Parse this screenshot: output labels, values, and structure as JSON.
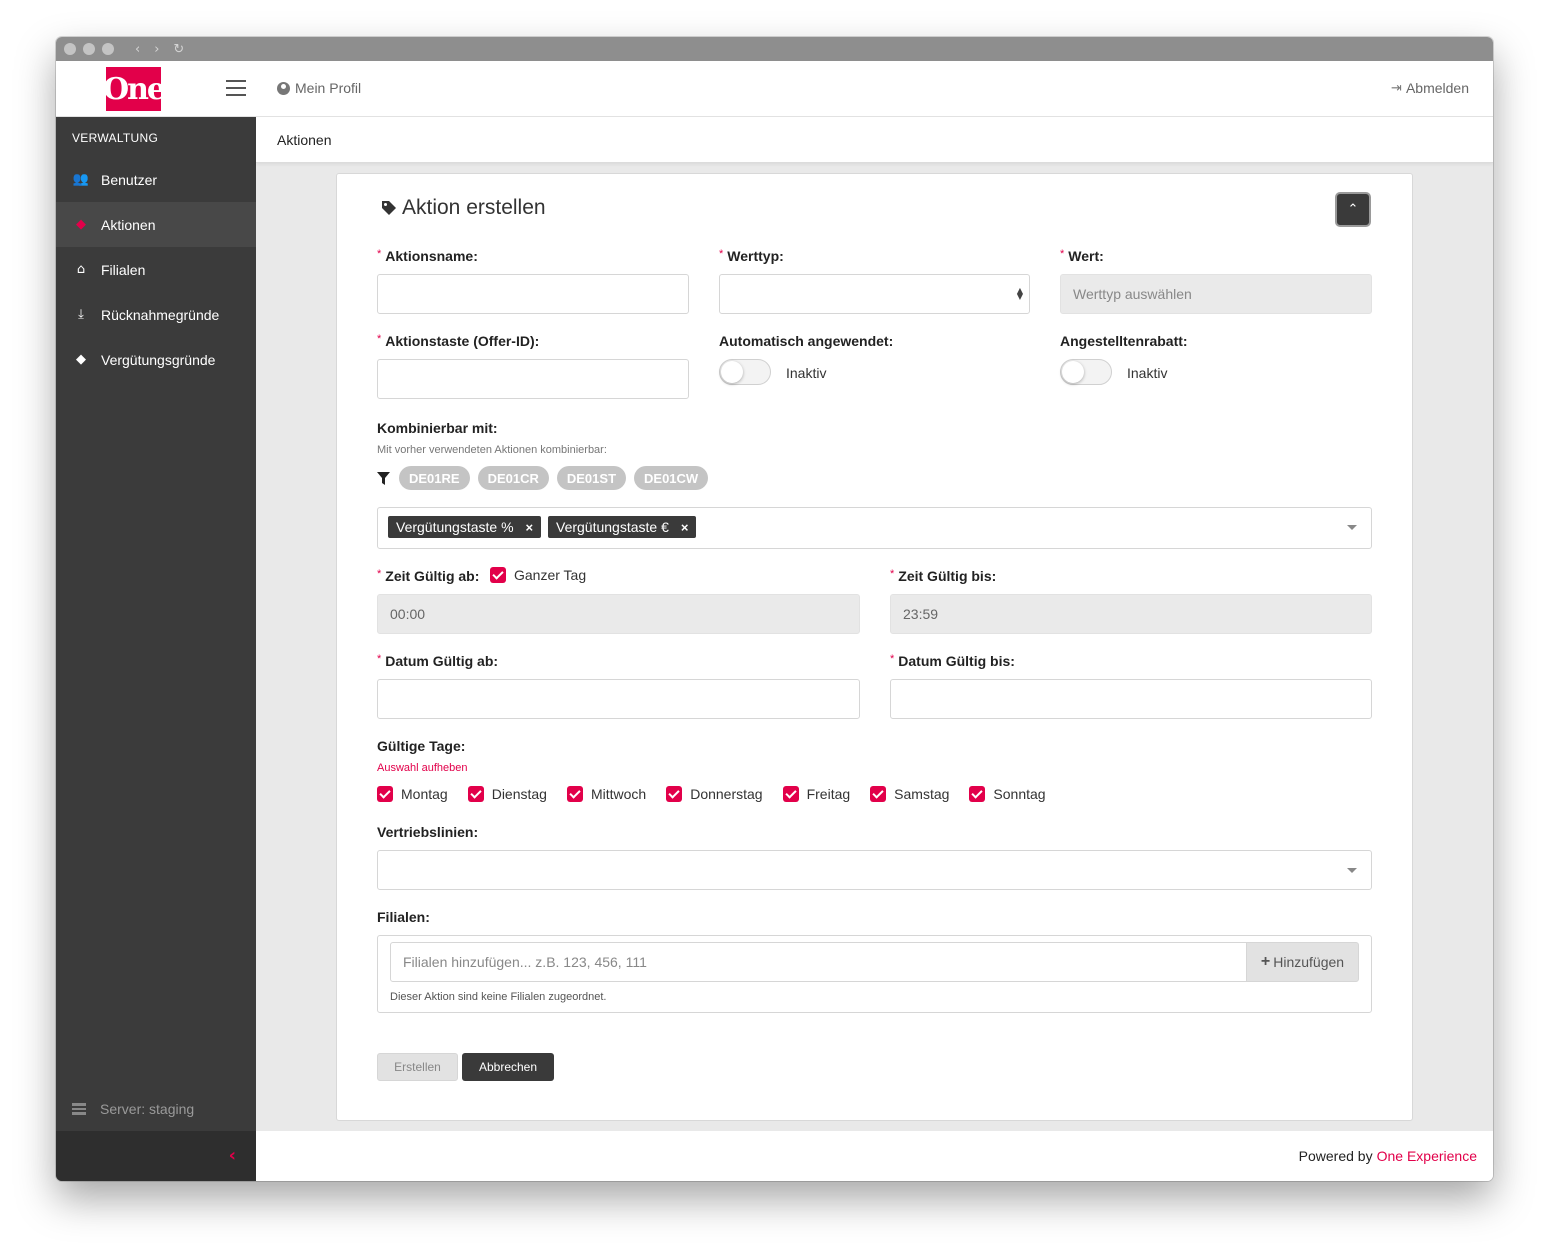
{
  "app": {
    "logo_text": "One",
    "brand_color": "#e2004a"
  },
  "topbar": {
    "profile_label": "Mein Profil",
    "logout_label": "Abmelden"
  },
  "sidebar": {
    "heading": "VERWALTUNG",
    "items": [
      {
        "label": "Benutzer",
        "icon": "users-icon",
        "glyph": "👥"
      },
      {
        "label": "Aktionen",
        "icon": "tags-icon",
        "glyph": "◆",
        "active": true
      },
      {
        "label": "Filialen",
        "icon": "store-icon",
        "glyph": "⌂"
      },
      {
        "label": "Rücknahmegründe",
        "icon": "hand-holding-icon",
        "glyph": "⤓"
      },
      {
        "label": "Vergütungsgründe",
        "icon": "tag-icon",
        "glyph": "◆"
      }
    ],
    "server_label": "Server: staging",
    "collapse_glyph": "‹"
  },
  "breadcrumb": "Aktionen",
  "form": {
    "title": "Aktion erstellen",
    "collapse_glyph": "⌃",
    "aktionsname_label": "Aktionsname:",
    "werttyp_label": "Werttyp:",
    "wert_label": "Wert:",
    "wert_placeholder": "Werttyp auswählen",
    "aktionstaste_label": "Aktionstaste (Offer-ID):",
    "auto_label": "Automatisch angewendet:",
    "auto_state": "Inaktiv",
    "angestellten_label": "Angestelltenrabatt:",
    "angestellten_state": "Inaktiv",
    "kombinierbar_label": "Kombinierbar mit:",
    "kombinierbar_hint": "Mit vorher verwendeten Aktionen kombinierbar:",
    "chips": [
      "DE01RE",
      "DE01CR",
      "DE01ST",
      "DE01CW"
    ],
    "selected_tags": [
      "Vergütungstaste %",
      "Vergütungstaste €"
    ],
    "zeit_ab_label": "Zeit Gültig ab:",
    "ganzer_tag_label": "Ganzer Tag",
    "zeit_ab_value": "00:00",
    "zeit_bis_label": "Zeit Gültig bis:",
    "zeit_bis_value": "23:59",
    "datum_ab_label": "Datum Gültig ab:",
    "datum_bis_label": "Datum Gültig bis:",
    "tage_label": "Gültige Tage:",
    "auswahl_link": "Auswahl aufheben",
    "days": [
      "Montag",
      "Dienstag",
      "Mittwoch",
      "Donnerstag",
      "Freitag",
      "Samstag",
      "Sonntag"
    ],
    "vertrieb_label": "Vertriebslinien:",
    "filialen_label": "Filialen:",
    "filialen_placeholder": "Filialen hinzufügen...  z.B. 123, 456, 111",
    "add_button": "Hinzufügen",
    "filialen_note": "Dieser Aktion sind keine Filialen zugeordnet.",
    "create_button": "Erstellen",
    "cancel_button": "Abbrechen"
  },
  "footer": {
    "powered_by": "Powered by",
    "brand": "One Experience"
  }
}
